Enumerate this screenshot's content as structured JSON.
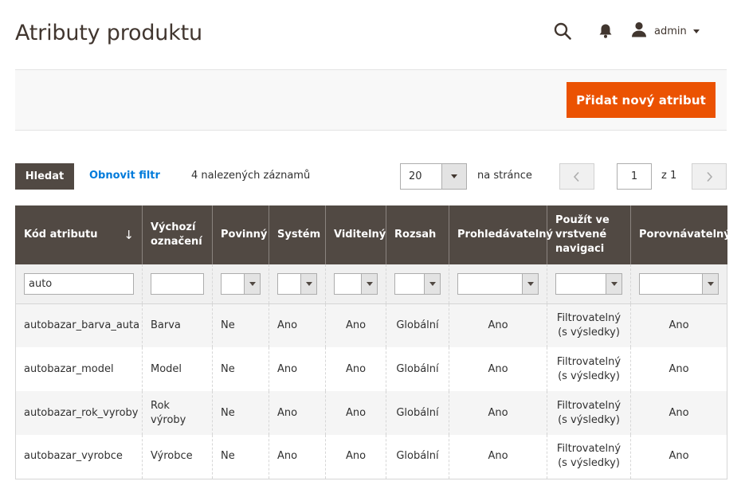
{
  "page": {
    "title": "Atributy produktu"
  },
  "header": {
    "username": "admin"
  },
  "actions": {
    "add_attribute_label": "Přidat nový atribut"
  },
  "toolbar": {
    "search_label": "Hledat",
    "reset_filter_label": "Obnovit filtr",
    "records_found": "4 nalezených záznamů",
    "per_page_value": "20",
    "per_page_label": "na stránce",
    "current_page": "1",
    "page_of": "z 1"
  },
  "grid": {
    "columns": [
      "Kód atributu",
      "Výchozí označení",
      "Povinný",
      "Systém",
      "Viditelný",
      "Rozsah",
      "Prohledávatelný",
      "Použít ve vrstvené navigaci",
      "Porovnávatelný"
    ],
    "sort_indicator": "↓",
    "filter_code_value": "auto",
    "rows": [
      [
        "autobazar_barva_auta",
        "Barva",
        "Ne",
        "Ano",
        "Ano",
        "Globální",
        "Ano",
        "Filtrovatelný (s výsledky)",
        "Ano"
      ],
      [
        "autobazar_model",
        "Model",
        "Ne",
        "Ano",
        "Ano",
        "Globální",
        "Ano",
        "Filtrovatelný (s výsledky)",
        "Ano"
      ],
      [
        "autobazar_rok_vyroby",
        "Rok výroby",
        "Ne",
        "Ano",
        "Ano",
        "Globální",
        "Ano",
        "Filtrovatelný (s výsledky)",
        "Ano"
      ],
      [
        "autobazar_vyrobce",
        "Výrobce",
        "Ne",
        "Ano",
        "Ano",
        "Globální",
        "Ano",
        "Filtrovatelný (s výsledky)",
        "Ano"
      ]
    ]
  },
  "colors": {
    "accent": "#eb5202",
    "header_bg": "#514943",
    "link": "#007bdb"
  }
}
